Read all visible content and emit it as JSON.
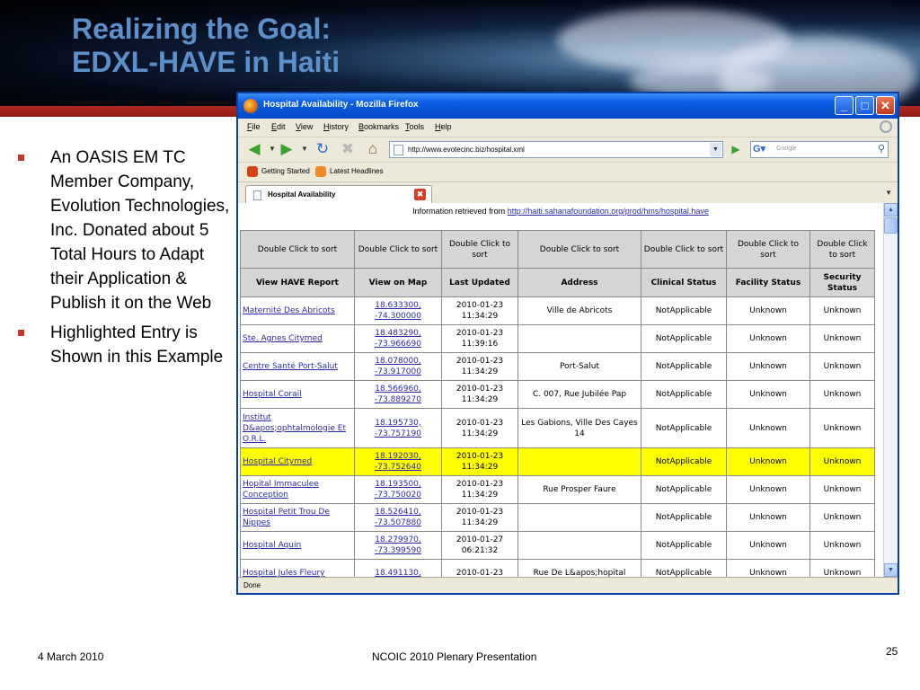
{
  "slide": {
    "title_line1": "Realizing the Goal:",
    "title_line2": "EDXL-HAVE in Haiti",
    "bullets": [
      "An OASIS EM TC Member Company, Evolution Technologies, Inc. Donated about 5 Total Hours to Adapt their Application & Publish it on the Web",
      "Highlighted Entry is Shown in this Example"
    ],
    "footer_date": "4 March 2010",
    "footer_center": "NCOIC 2010 Plenary Presentation",
    "page_number": "25",
    "colors": {
      "title": "#5d8fc9",
      "accent_bar": "#b22a1f",
      "bullet": "#c0392b"
    }
  },
  "browser": {
    "window_title": "Hospital Availability - Mozilla Firefox",
    "controls": {
      "minimize": "_",
      "maximize": "□",
      "close": "✕"
    },
    "menu": [
      "File",
      "Edit",
      "View",
      "History",
      "Bookmarks",
      "Tools",
      "Help"
    ],
    "url": "http://www.evotecinc.biz/hospital.xml",
    "search_placeholder": "Google",
    "bookmarks": [
      "Getting Started",
      "Latest Headlines"
    ],
    "tab_label": "Hospital Availability",
    "status": "Done",
    "icons": [
      "firefox-icon",
      "back-icon",
      "forward-icon",
      "reload-icon",
      "stop-icon",
      "home-icon",
      "go-icon",
      "google-icon",
      "magnifier-icon",
      "rss-icon"
    ]
  },
  "page": {
    "info_prefix": "Information retrieved from",
    "info_link": "http://haiti.sahanafoundation.org/prod/hms/hospital.have",
    "sort_headers": [
      "Double Click to sort",
      "Double Click to sort",
      "Double Click to sort",
      "Double Click to sort",
      "Double Click to sort",
      "Double Click to sort",
      "Double Click to sort"
    ],
    "column_headers": [
      "View HAVE Report",
      "View on Map",
      "Last Updated",
      "Address",
      "Clinical Status",
      "Facility Status",
      "Security Status"
    ],
    "rows": [
      {
        "name": "Maternité Des Abricots",
        "coords": "18.633300, -74.300000",
        "updated": "2010-01-23 11:34:29",
        "address": "Ville de Abricots",
        "clinical": "NotApplicable",
        "facility": "Unknown",
        "security": "Unknown",
        "highlight": false
      },
      {
        "name": "Ste. Agnes Citymed",
        "coords": "18.483290, -73.966690",
        "updated": "2010-01-23 11:39:16",
        "address": "",
        "clinical": "NotApplicable",
        "facility": "Unknown",
        "security": "Unknown",
        "highlight": false
      },
      {
        "name": "Centre Santé Port-Salut",
        "coords": "18.078000, -73.917000",
        "updated": "2010-01-23 11:34:29",
        "address": "Port-Salut",
        "clinical": "NotApplicable",
        "facility": "Unknown",
        "security": "Unknown",
        "highlight": false
      },
      {
        "name": "Hospital Corail",
        "coords": "18.566960, -73.889270",
        "updated": "2010-01-23 11:34:29",
        "address": "C. 007, Rue Jubilée Pap",
        "clinical": "NotApplicable",
        "facility": "Unknown",
        "security": "Unknown",
        "highlight": false
      },
      {
        "name": "Institut D&apos;ophtalmologie Et O.R.L.",
        "coords": "18.195730, -73.757190",
        "updated": "2010-01-23 11:34:29",
        "address": "Les Gabions, Ville Des Cayes 14",
        "clinical": "NotApplicable",
        "facility": "Unknown",
        "security": "Unknown",
        "highlight": false
      },
      {
        "name": "Hospital Citymed",
        "coords": "18.192030, -73.752640",
        "updated": "2010-01-23 11:34:29",
        "address": "",
        "clinical": "NotApplicable",
        "facility": "Unknown",
        "security": "Unknown",
        "highlight": true
      },
      {
        "name": "Hopital Immaculee Conception",
        "coords": "18.193500, -73.750020",
        "updated": "2010-01-23 11:34:29",
        "address": "Rue Prosper Faure",
        "clinical": "NotApplicable",
        "facility": "Unknown",
        "security": "Unknown",
        "highlight": false
      },
      {
        "name": "Hospital Petit Trou De Nippes",
        "coords": "18.526410, -73.507880",
        "updated": "2010-01-23 11:34:29",
        "address": "",
        "clinical": "NotApplicable",
        "facility": "Unknown",
        "security": "Unknown",
        "highlight": false
      },
      {
        "name": "Hospital Aquin",
        "coords": "18.279970, -73.399590",
        "updated": "2010-01-27 06:21:32",
        "address": "",
        "clinical": "NotApplicable",
        "facility": "Unknown",
        "security": "Unknown",
        "highlight": false
      },
      {
        "name": "Hospital Jules Fleury",
        "coords": "18.491130,",
        "updated": "2010-01-23",
        "address": "Rue De L&apos;hopital",
        "clinical": "NotApplicable",
        "facility": "Unknown",
        "security": "Unknown",
        "highlight": false
      }
    ]
  }
}
